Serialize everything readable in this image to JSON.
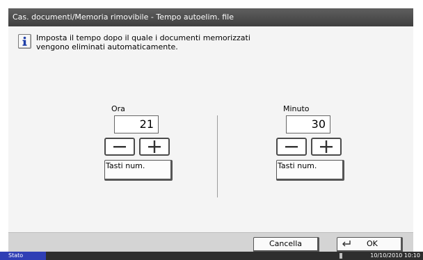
{
  "window": {
    "title": "Cas. documenti/Memoria rimovibile - Tempo autoelim. file"
  },
  "info": {
    "icon": "info-icon",
    "line1": "Imposta il tempo dopo il quale i documenti memorizzati",
    "line2": "vengono eliminati automaticamente."
  },
  "hour": {
    "label": "Ora",
    "value": "21",
    "numkeys_label": "Tasti num."
  },
  "minute": {
    "label": "Minuto",
    "value": "30",
    "numkeys_label": "Tasti num."
  },
  "footer": {
    "cancel_label": "Cancella",
    "ok_label": "OK"
  },
  "statusbar": {
    "status_label": "Stato",
    "datetime": "10/10/2010  10:10"
  },
  "colors": {
    "titlebar": "#4a4a4a",
    "status_accent": "#2f3fb5",
    "panel_bg": "#f4f4f4"
  }
}
